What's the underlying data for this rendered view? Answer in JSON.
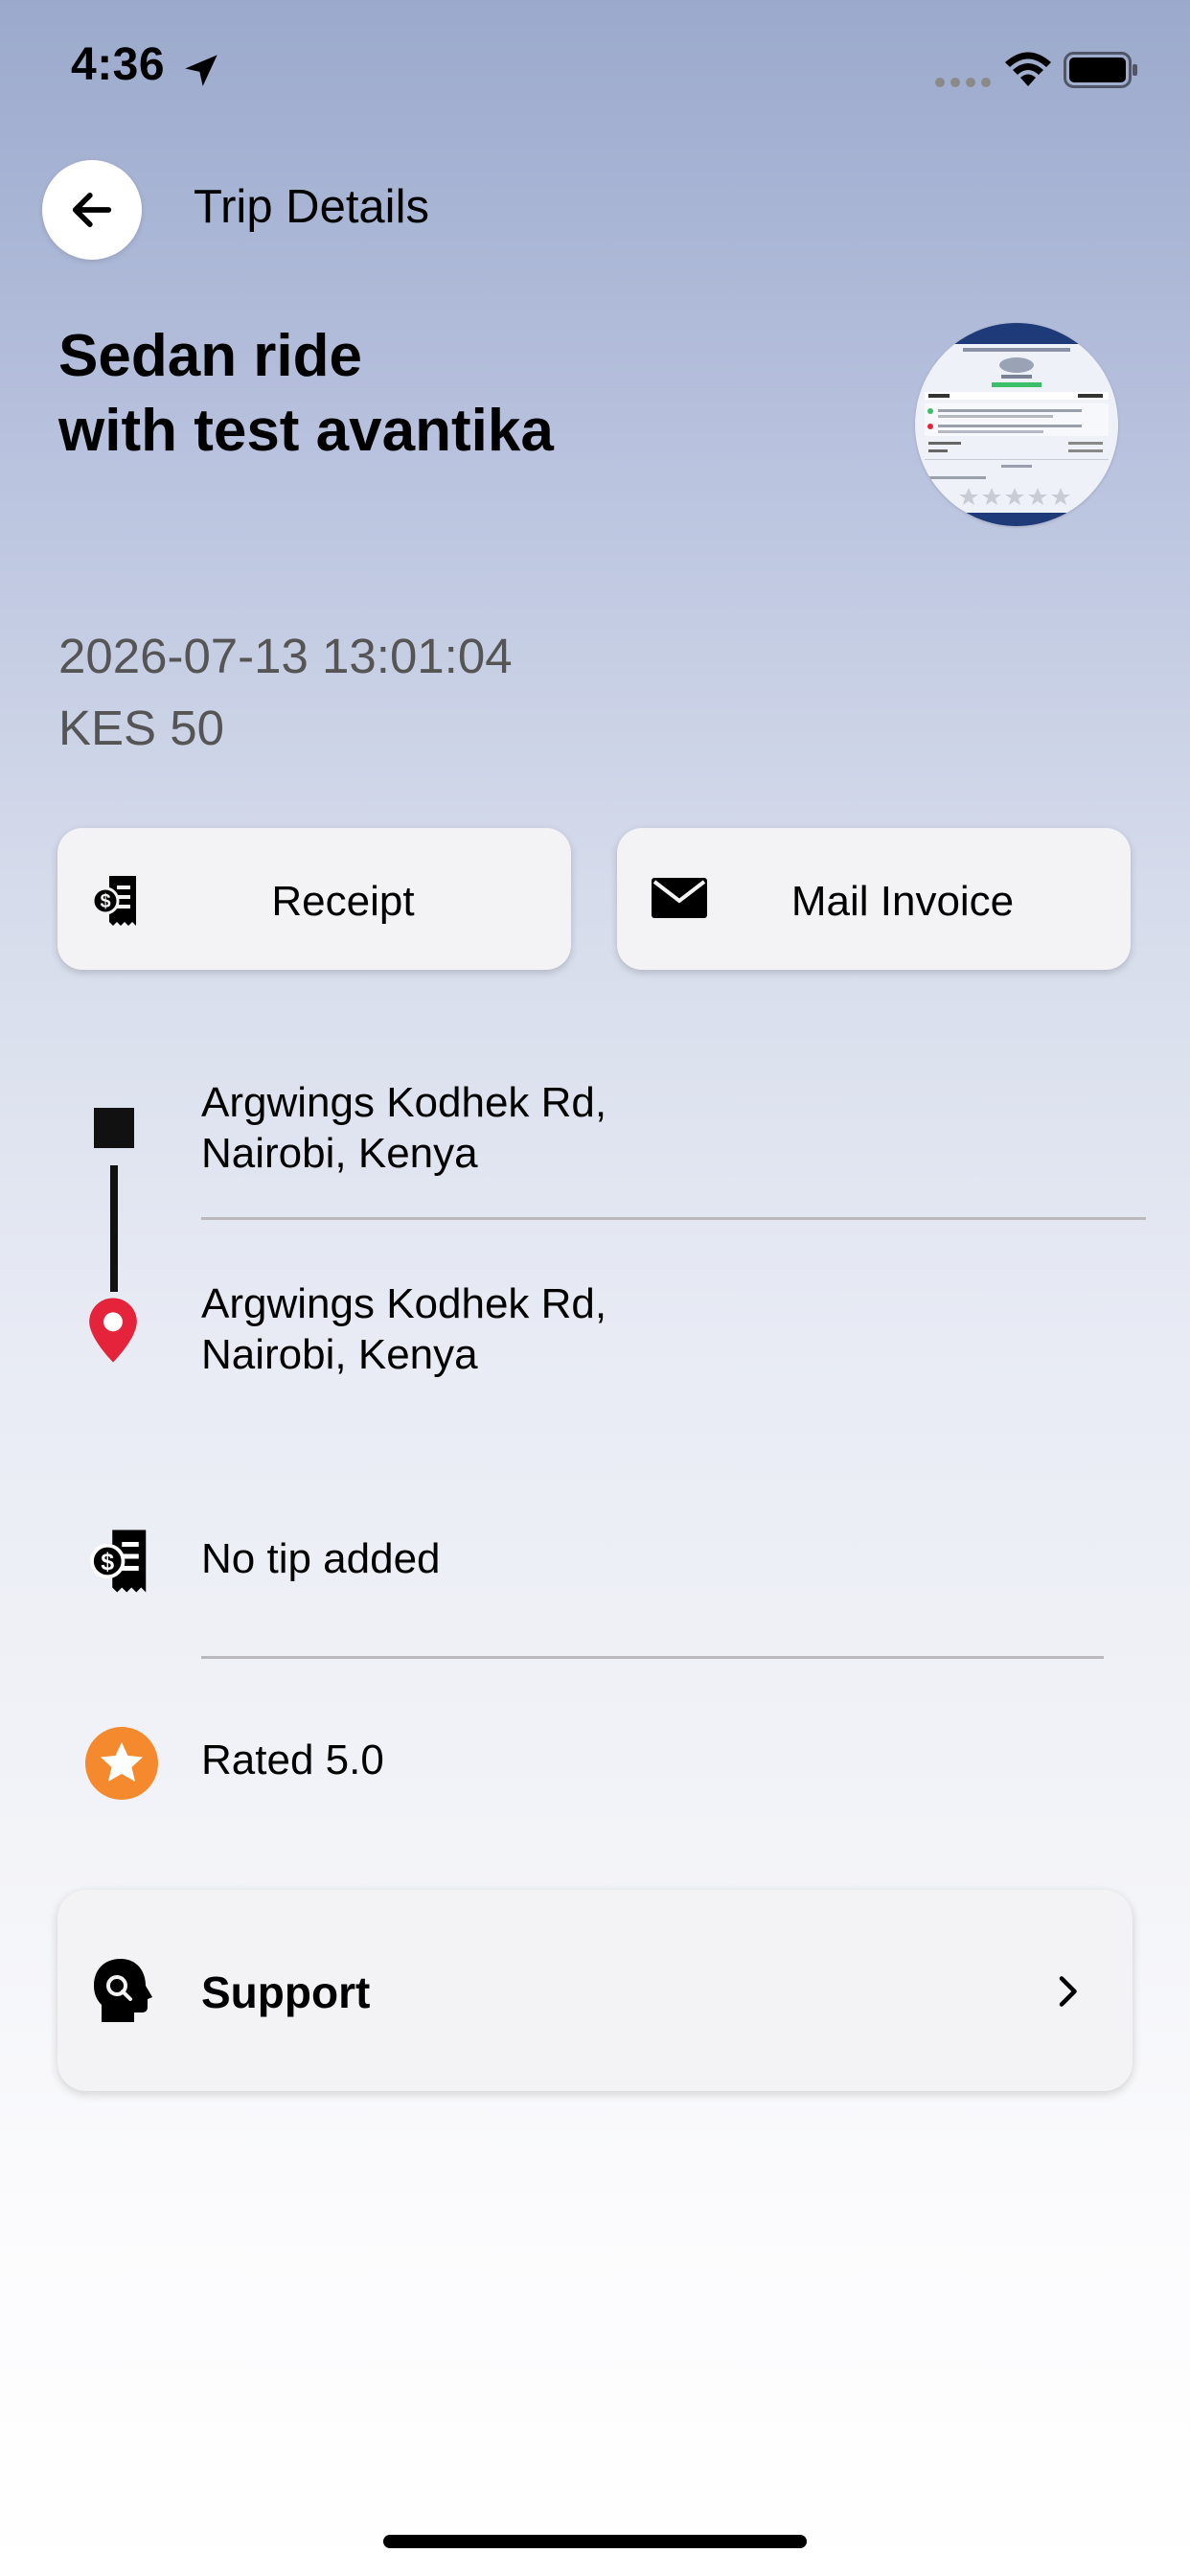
{
  "status_bar": {
    "time": "4:36",
    "icons": [
      "location-arrow-icon",
      "signal-icon",
      "wifi-icon",
      "battery-icon"
    ]
  },
  "header": {
    "title": "Trip Details",
    "back_icon": "arrow-left-icon"
  },
  "trip": {
    "title_line1": "Sedan ride",
    "title_line2": "with test avantika",
    "datetime": "2026-07-13 13:01:04",
    "fare": "KES 50"
  },
  "actions": {
    "receipt_label": "Receipt",
    "mail_invoice_label": "Mail Invoice"
  },
  "route": {
    "pickup": {
      "line1": "Argwings Kodhek Rd,",
      "line2": "Nairobi, Kenya"
    },
    "dropoff": {
      "line1": "Argwings Kodhek Rd,",
      "line2": "Nairobi, Kenya"
    }
  },
  "tip": {
    "text": "No tip added"
  },
  "rating": {
    "text": "Rated 5.0"
  },
  "support": {
    "label": "Support"
  },
  "colors": {
    "accent_orange": "#f5892d",
    "pin_red": "#e5233a"
  }
}
